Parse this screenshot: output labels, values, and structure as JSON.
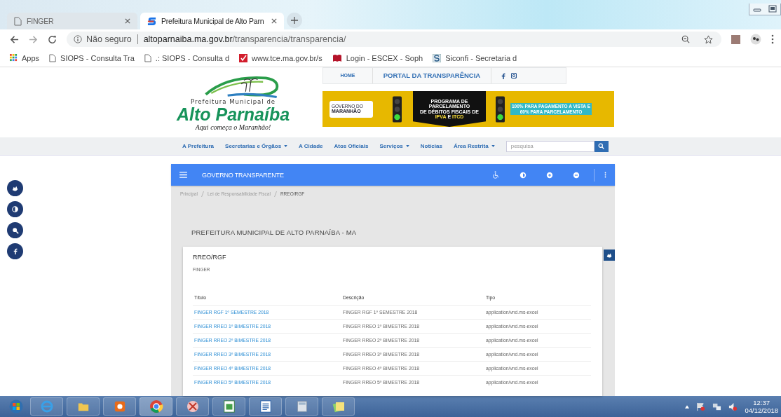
{
  "browser": {
    "tabs": [
      {
        "title": "FINGER",
        "selected": false
      },
      {
        "title": "Prefeitura Municipal de Alto Parn",
        "selected": true
      }
    ],
    "address": {
      "security": "Não seguro",
      "domain": "altoparnaiba.ma.gov.br",
      "path": "/transparencia/transparencia/"
    },
    "bookmarks": [
      {
        "label": "Apps",
        "kind": "apps"
      },
      {
        "label": "SIOPS - Consulta Tra",
        "kind": "page"
      },
      {
        "label": ".: SIOPS - Consulta d",
        "kind": "page"
      },
      {
        "label": "www.tce.ma.gov.br/s",
        "kind": "tce"
      },
      {
        "label": "Login - ESCEX - Soph",
        "kind": "book"
      },
      {
        "label": "Siconfi - Secretaria d",
        "kind": "siconfi"
      }
    ]
  },
  "site": {
    "logo": {
      "line1": "Prefeitura Municipal de",
      "name": "Alto Parnaíba",
      "slogan": "Aqui começa o Maranhão!"
    },
    "top_nav": {
      "home": "HOME",
      "portal": "PORTAL DA TRANSPARÊNCIA"
    },
    "banner": {
      "gov_line1": "GOVERNO DO",
      "gov_line2": "MARANHÃO",
      "headline": [
        "PROGRAMA DE",
        "PARCELAMENTO",
        "DE DÉBITOS FISCAIS DE"
      ],
      "taxes_a": "IPVA",
      "taxes_and": "E",
      "taxes_b": "ITCD",
      "side_note": [
        "100% PARA PAGAMENTO A VISTA E",
        "60% PARA PARCELAMENTO"
      ]
    },
    "menu": [
      {
        "label": "A Prefeitura",
        "dropdown": false
      },
      {
        "label": "Secretarias e Órgãos",
        "dropdown": true
      },
      {
        "label": "A Cidade",
        "dropdown": false
      },
      {
        "label": "Atos Oficiais",
        "dropdown": false
      },
      {
        "label": "Serviços",
        "dropdown": true
      },
      {
        "label": "Notícias",
        "dropdown": false
      },
      {
        "label": "Área Restrita",
        "dropdown": true
      }
    ],
    "search": {
      "placeholder": "pesquisa"
    }
  },
  "portal": {
    "title": "GOVERNO TRANSPARENTE",
    "breadcrumb": [
      {
        "label": "Principal",
        "current": false
      },
      {
        "label": "Lei de Responsabilidade Fiscal",
        "current": false
      },
      {
        "label": "RREO/RGF",
        "current": true
      }
    ],
    "heading": "PREFEITURA MUNICIPAL DE ALTO PARNAÍBA - MA",
    "card": {
      "title": "RREO/RGF",
      "subtitle": "FINGER",
      "table": {
        "columns": [
          "Título",
          "Descrição",
          "Tipo"
        ],
        "rows": [
          [
            "FINGER RGF 1º SEMESTRE 2018",
            "FINGER RGF 1º SEMESTRE 2018",
            "application/vnd.ms-excel"
          ],
          [
            "FINGER RREO 1º BIMESTRE 2018",
            "FINGER RREO 1º BIMESTRE 2018",
            "application/vnd.ms-excel"
          ],
          [
            "FINGER RREO 2º BIMESTRE 2018",
            "FINGER RREO 2º BIMESTRE 2018",
            "application/vnd.ms-excel"
          ],
          [
            "FINGER RREO 3º BIMESTRE 2018",
            "FINGER RREO 3º BIMESTRE 2018",
            "application/vnd.ms-excel"
          ],
          [
            "FINGER RREO 4º BIMESTRE 2018",
            "FINGER RREO 4º BIMESTRE 2018",
            "application/vnd.ms-excel"
          ],
          [
            "FINGER RREO 5º BIMESTRE 2018",
            "FINGER RREO 5º BIMESTRE 2018",
            "application/vnd.ms-excel"
          ]
        ]
      }
    }
  },
  "taskbar": {
    "time": "12:37",
    "date": "04/12/2018"
  }
}
